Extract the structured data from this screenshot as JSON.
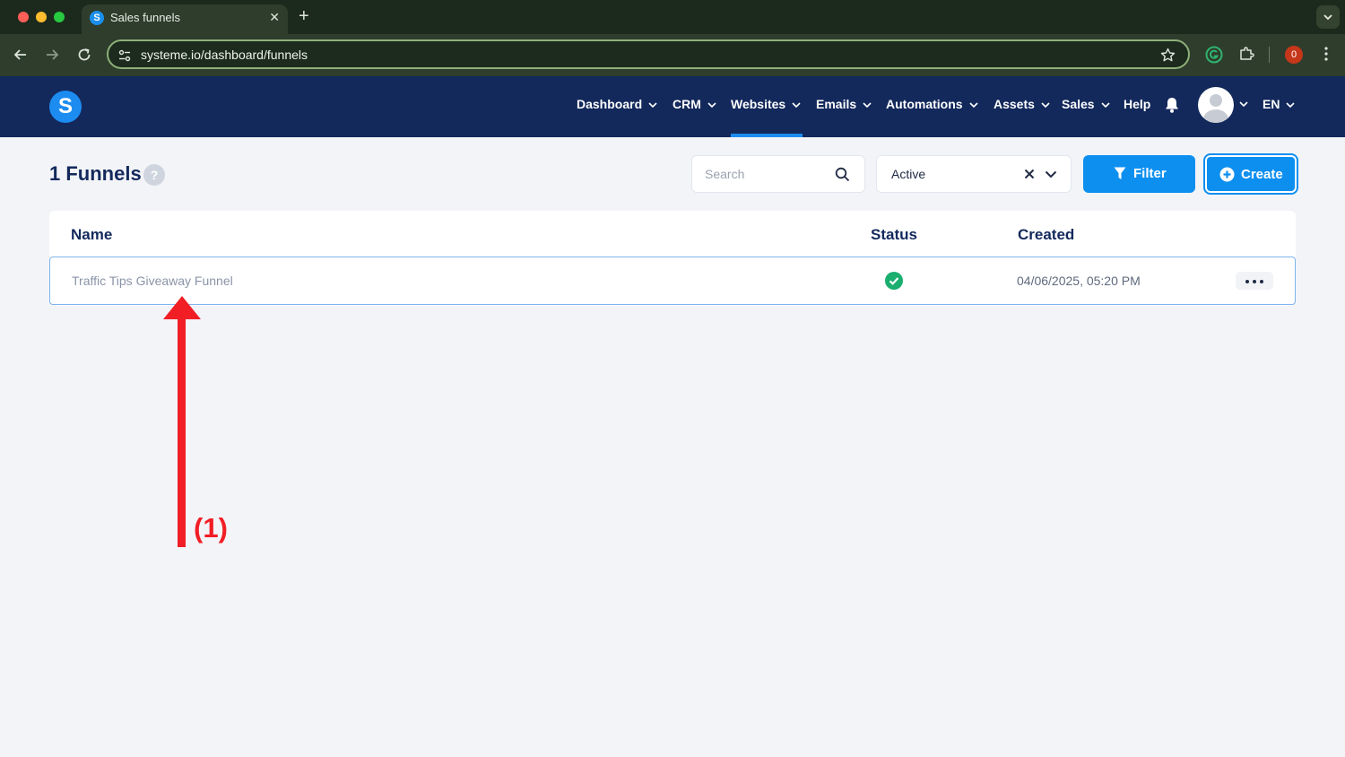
{
  "browser": {
    "tab_title": "Sales funnels",
    "tab_favicon_letter": "S",
    "tab_close": "✕",
    "new_tab": "+",
    "url": "systeme.io/dashboard/funnels",
    "extension_badge_count": "0"
  },
  "header": {
    "logo_letter": "S",
    "nav": [
      {
        "label": "Dashboard",
        "has_menu": true
      },
      {
        "label": "CRM",
        "has_menu": true
      },
      {
        "label": "Websites",
        "has_menu": true,
        "active": true
      },
      {
        "label": "Emails",
        "has_menu": true
      },
      {
        "label": "Automations",
        "has_menu": true
      },
      {
        "label": "Assets",
        "has_menu": true
      },
      {
        "label": "Sales",
        "has_menu": true
      },
      {
        "label": "Help",
        "has_menu": false
      }
    ],
    "language": "EN",
    "icons": [
      "bell-icon",
      "avatar",
      "chevron-down-icon"
    ]
  },
  "page": {
    "title": "1 Funnels",
    "help_glyph": "?",
    "search": {
      "placeholder": "Search"
    },
    "status_filter": {
      "selected": "Active"
    },
    "filter_button": "Filter",
    "create_button": "Create"
  },
  "table": {
    "columns": [
      "Name",
      "Status",
      "Created"
    ],
    "rows": [
      {
        "name": "Traffic Tips Giveaway Funnel",
        "status": "active",
        "created": "04/06/2025, 05:20 PM"
      }
    ]
  },
  "annotation": {
    "label": "(1)",
    "color": "#f21e25"
  },
  "colors": {
    "brand_navy": "#13295c",
    "accent_blue": "#0d8ff0",
    "success_green": "#1aae6f"
  }
}
